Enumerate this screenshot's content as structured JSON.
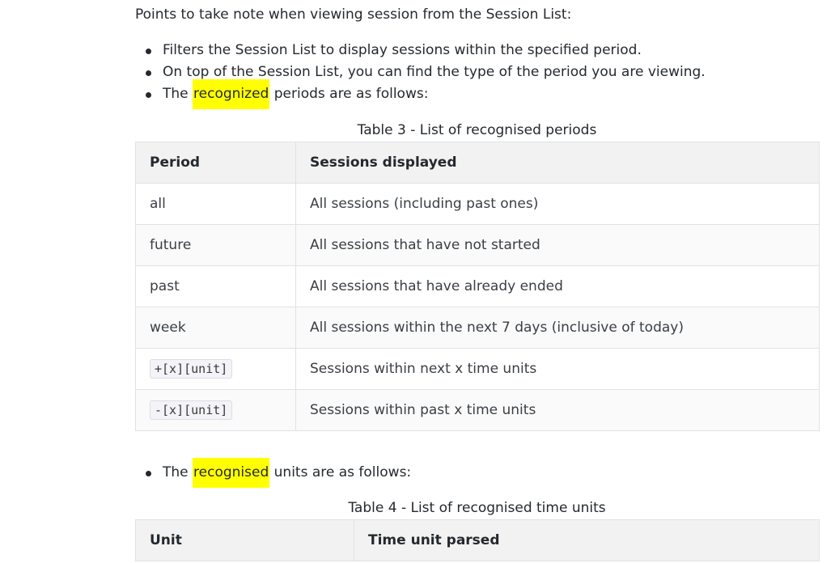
{
  "intro": "Points to take note when viewing session from the Session List:",
  "bullets_top": {
    "b1": "Filters the Session List to display sessions within the specified period.",
    "b2": "On top of the Session List, you can find the type of the period you are viewing.",
    "b3": {
      "pre": "The ",
      "highlight": "recognized",
      "post": " periods are as follows:"
    }
  },
  "table3": {
    "caption": "Table 3 - List of recognised periods",
    "headers": [
      "Period",
      "Sessions displayed"
    ],
    "rows": [
      {
        "period": "all",
        "desc": "All sessions (including past ones)"
      },
      {
        "period": "future",
        "desc": "All sessions that have not started"
      },
      {
        "period": "past",
        "desc": "All sessions that have already ended"
      },
      {
        "period": "week",
        "desc": "All sessions within the next 7 days (inclusive of today)"
      },
      {
        "period": "+[x][unit]",
        "desc": "Sessions within next x time units"
      },
      {
        "period": "-[x][unit]",
        "desc": "Sessions within past x time units"
      }
    ]
  },
  "bullets_bottom": {
    "b1": {
      "pre": "The ",
      "highlight": "recognised",
      "post": " units are as follows:"
    }
  },
  "table4": {
    "caption": "Table 4 - List of recognised time units",
    "headers": [
      "Unit",
      "Time unit parsed"
    ]
  },
  "colors": {
    "highlight": "#ffff00",
    "header_bg": "#f2f2f2",
    "border": "#dfe2e5"
  }
}
